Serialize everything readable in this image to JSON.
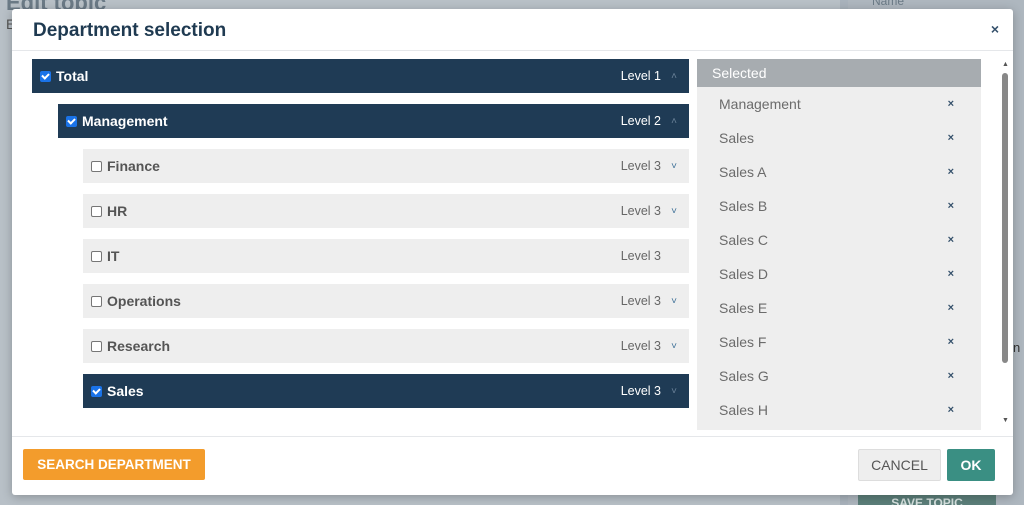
{
  "background": {
    "title_fragment": "Edit topic",
    "e_fragment": "E",
    "name_fragment": "Name",
    "n_fragment": "n",
    "save_button_fragment": "SAVE TOPIC"
  },
  "dialog": {
    "title": "Department selection",
    "close_icon": "×"
  },
  "tree": {
    "rows": [
      {
        "label": "Total",
        "level": "Level 1",
        "checked": true,
        "chevron": "˄"
      },
      {
        "label": "Management",
        "level": "Level 2",
        "checked": true,
        "chevron": "˄"
      },
      {
        "label": "Finance",
        "level": "Level 3",
        "checked": false,
        "chevron": "˅"
      },
      {
        "label": "HR",
        "level": "Level 3",
        "checked": false,
        "chevron": "˅"
      },
      {
        "label": "IT",
        "level": "Level 3",
        "checked": false,
        "chevron": ""
      },
      {
        "label": "Operations",
        "level": "Level 3",
        "checked": false,
        "chevron": "˅"
      },
      {
        "label": "Research",
        "level": "Level 3",
        "checked": false,
        "chevron": "˅"
      },
      {
        "label": "Sales",
        "level": "Level 3",
        "checked": true,
        "chevron": "˅"
      }
    ]
  },
  "selected": {
    "header": "Selected",
    "remove_icon": "×",
    "items": [
      "Management",
      "Sales",
      "Sales A",
      "Sales B",
      "Sales C",
      "Sales D",
      "Sales E",
      "Sales F",
      "Sales G",
      "Sales H"
    ]
  },
  "footer": {
    "search_label": "SEARCH DEPARTMENT",
    "cancel_label": "CANCEL",
    "ok_label": "OK"
  },
  "colors": {
    "dark_row": "#1f3b55",
    "light_row": "#eeeeee",
    "search_button": "#f39c2c",
    "ok_button": "#3a8f83",
    "selected_header": "#a7acb0"
  }
}
